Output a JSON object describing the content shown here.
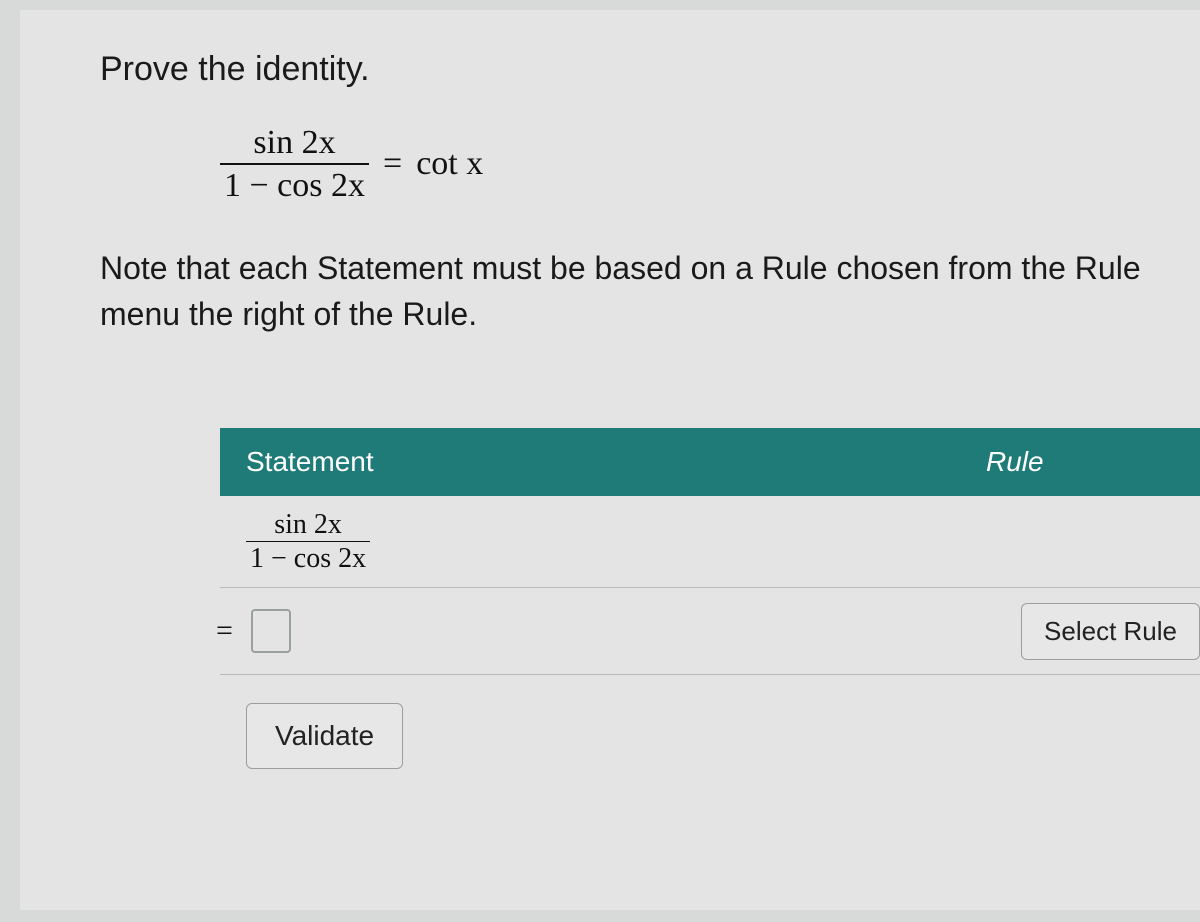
{
  "prompt": "Prove the identity.",
  "identity": {
    "lhs_num": "sin 2x",
    "lhs_den": "1 − cos 2x",
    "eq": "=",
    "rhs": "cot x"
  },
  "note": "Note that each Statement must be based on a Rule chosen from the Rule menu the right of the Rule.",
  "table": {
    "header_statement": "Statement",
    "header_rule": "Rule",
    "row1": {
      "num": "sin 2x",
      "den": "1 −  cos 2x"
    },
    "row2": {
      "eq": "=",
      "select_rule": "Select Rule"
    },
    "validate": "Validate"
  }
}
